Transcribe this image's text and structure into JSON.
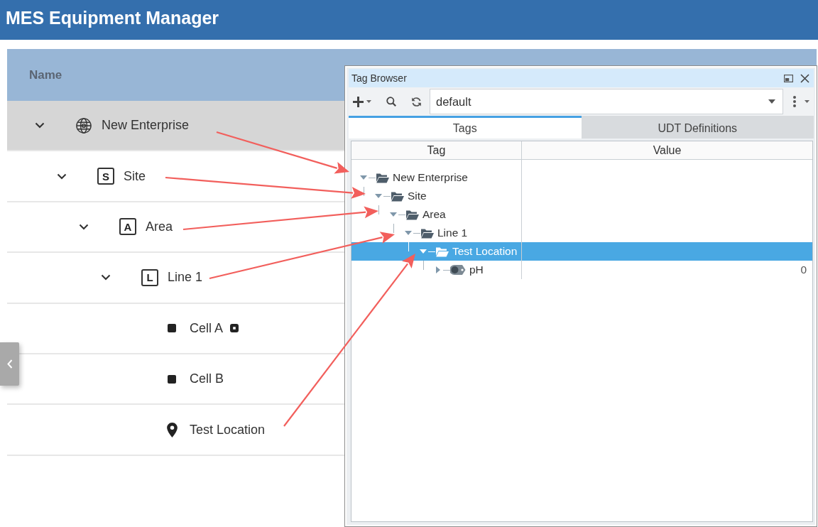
{
  "app_title": "MES Equipment Manager",
  "equipment_table": {
    "columns": [
      "Name"
    ],
    "rows": [
      {
        "name": "New Enterprise",
        "kind": "enterprise",
        "selected": true,
        "expanded": true,
        "children": [
          {
            "name": "Site",
            "kind": "site",
            "letter": "S",
            "selected": false,
            "expanded": true,
            "children": [
              {
                "name": "Area",
                "kind": "area",
                "letter": "A",
                "selected": false,
                "expanded": true,
                "children": [
                  {
                    "name": "Line 1",
                    "kind": "line",
                    "letter": "L",
                    "selected": false,
                    "expanded": true,
                    "children": [
                      {
                        "name": "Cell A",
                        "kind": "cell",
                        "selected": false,
                        "flagged": true
                      },
                      {
                        "name": "Cell B",
                        "kind": "cell",
                        "selected": false,
                        "flagged": false
                      },
                      {
                        "name": "Test Location",
                        "kind": "location",
                        "selected": false,
                        "flagged": false
                      }
                    ]
                  }
                ]
              }
            ]
          }
        ]
      }
    ]
  },
  "tag_browser": {
    "title": "Tag Browser",
    "provider": "default",
    "tabs": [
      {
        "label": "Tags",
        "selected": true
      },
      {
        "label": "UDT Definitions",
        "selected": false
      }
    ],
    "columns": [
      "Tag",
      "Value"
    ],
    "tree": [
      {
        "name": "New Enterprise",
        "kind": "folder",
        "expanded": true,
        "selected": false,
        "children": [
          {
            "name": "Site",
            "kind": "folder",
            "expanded": true,
            "selected": false,
            "children": [
              {
                "name": "Area",
                "kind": "folder",
                "expanded": true,
                "selected": false,
                "children": [
                  {
                    "name": "Line 1",
                    "kind": "folder",
                    "expanded": true,
                    "selected": false,
                    "children": [
                      {
                        "name": "Test Location",
                        "kind": "folder",
                        "expanded": true,
                        "selected": true,
                        "children": [
                          {
                            "name": "pH",
                            "kind": "tag",
                            "expanded": false,
                            "selected": false,
                            "value": "0"
                          }
                        ]
                      }
                    ]
                  }
                ]
              }
            ]
          }
        ]
      }
    ]
  }
}
